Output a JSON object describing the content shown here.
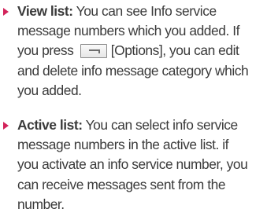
{
  "items": [
    {
      "term": "View list:",
      "lines": [
        " You can see Info service",
        "message numbers which you added. If",
        "you press ",
        "[Options], you can edit",
        "and delete info message category which",
        "you added."
      ],
      "icon": "options-key-icon"
    },
    {
      "term": "Active list:",
      "lines": [
        " You can select info service",
        "message numbers in the active list. if",
        "you activate an info service number, you",
        "can receive messages sent from the",
        "number."
      ]
    }
  ],
  "colors": {
    "bullet": "#d2235a",
    "text": "#3a3a3a"
  }
}
